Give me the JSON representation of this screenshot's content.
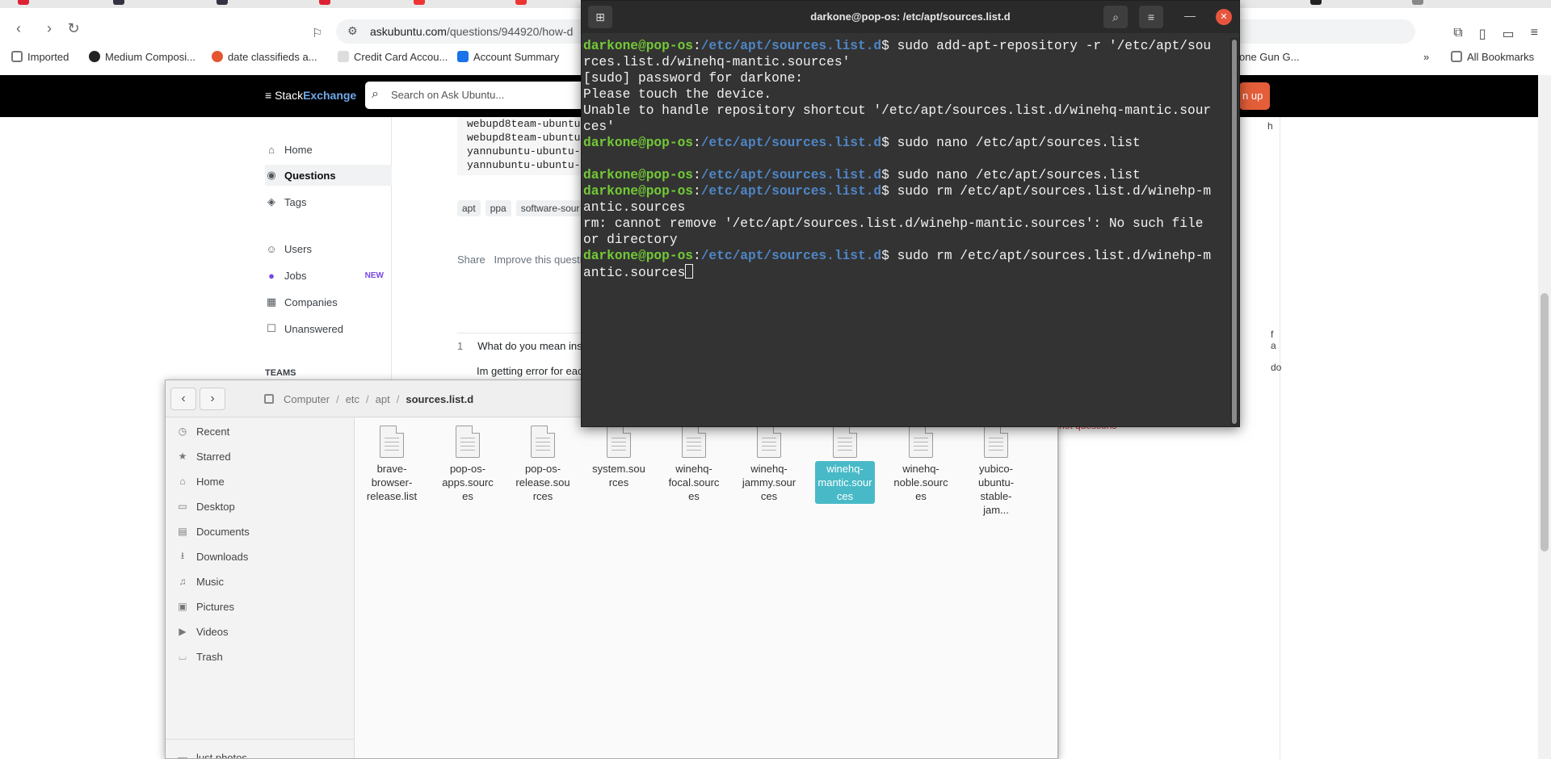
{
  "browser": {
    "url_host": "askubuntu.com",
    "url_path": "/questions/944920/how-d",
    "bookmarks": [
      {
        "label": "Imported",
        "color": "#777777"
      },
      {
        "label": "Medium Composi...",
        "color": "#222222"
      },
      {
        "label": "date classifieds a...",
        "color": "#e4572e"
      },
      {
        "label": "Credit Card Accou...",
        "color": "#bbbbbb"
      },
      {
        "label": "Account Summary",
        "color": "#1a73e8"
      },
      {
        "label": "one Gun G...",
        "color": "#777777"
      },
      {
        "label": "All Bookmarks",
        "color": "#777777"
      }
    ],
    "overflow_chevron": "»"
  },
  "site": {
    "logo_pre": "Stack",
    "logo_post": "Exchange",
    "search_placeholder": "Search on Ask Ubuntu...",
    "signup_fragment": "n up",
    "nav": [
      {
        "label": "Home",
        "icon": "home-icon"
      },
      {
        "label": "Questions",
        "icon": "questions-icon",
        "active": true
      },
      {
        "label": "Tags",
        "icon": "tag-icon"
      },
      {
        "label": "Users",
        "icon": "users-icon"
      },
      {
        "label": "Jobs",
        "icon": "jobs-icon",
        "badge": "NEW"
      },
      {
        "label": "Companies",
        "icon": "companies-icon"
      },
      {
        "label": "Unanswered",
        "icon": "unanswered-icon"
      }
    ],
    "teams_label": "TEAMS",
    "code_lines": [
      "webupd8team-ubuntu",
      "webupd8team-ubuntu",
      "yannubuntu-ubuntu-",
      "yannubuntu-ubuntu-"
    ],
    "tags": [
      "apt",
      "ppa",
      "software-sour"
    ],
    "share": "Share",
    "improve": "Improve this questio",
    "comment_score": "1",
    "comment_text": "What do you mean ins",
    "comment2_text": "Im getting error for eac",
    "right_fragments": [
      "h",
      "f a",
      "do",
      "hot questions"
    ]
  },
  "files": {
    "breadcrumb": [
      "Computer",
      "etc",
      "apt",
      "sources.list.d"
    ],
    "sidebar": [
      {
        "label": "Recent",
        "icon": "clock-icon"
      },
      {
        "label": "Starred",
        "icon": "star-icon"
      },
      {
        "label": "Home",
        "icon": "home-icon"
      },
      {
        "label": "Desktop",
        "icon": "desktop-icon"
      },
      {
        "label": "Documents",
        "icon": "documents-icon"
      },
      {
        "label": "Downloads",
        "icon": "download-icon"
      },
      {
        "label": "Music",
        "icon": "music-icon"
      },
      {
        "label": "Pictures",
        "icon": "pictures-icon"
      },
      {
        "label": "Videos",
        "icon": "videos-icon"
      },
      {
        "label": "Trash",
        "icon": "trash-icon"
      },
      {
        "label": "lust photos",
        "icon": "folder-icon"
      }
    ],
    "items": [
      {
        "label": "brave-browser-release.list"
      },
      {
        "label": "pop-os-apps.sources"
      },
      {
        "label": "pop-os-release.sources"
      },
      {
        "label": "system.sources"
      },
      {
        "label": "winehq-focal.sources"
      },
      {
        "label": "winehq-jammy.sources"
      },
      {
        "label": "winehq-mantic.sources",
        "selected": true
      },
      {
        "label": "winehq-noble.sources"
      },
      {
        "label": "yubico-ubuntu-stable-jam..."
      }
    ]
  },
  "terminal": {
    "title": "darkone@pop-os: /etc/apt/sources.list.d",
    "prompt_user": "darkone@pop-os",
    "prompt_path": "/etc/apt/sources.list.d",
    "lines": [
      {
        "type": "prompt",
        "text": "$ sudo add-apt-repository -r '/etc/apt/sou"
      },
      {
        "type": "out",
        "text": "rces.list.d/winehq-mantic.sources'"
      },
      {
        "type": "out",
        "text": "[sudo] password for darkone:"
      },
      {
        "type": "out",
        "text": "Please touch the device."
      },
      {
        "type": "out",
        "text": "Unable to handle repository shortcut '/etc/apt/sources.list.d/winehq-mantic.sour"
      },
      {
        "type": "out",
        "text": "ces'"
      },
      {
        "type": "prompt",
        "text": "$ sudo nano /etc/apt/sources.list"
      },
      {
        "type": "out",
        "text": ""
      },
      {
        "type": "prompt",
        "text": "$ sudo nano /etc/apt/sources.list"
      },
      {
        "type": "prompt",
        "text": "$ sudo rm /etc/apt/sources.list.d/winehp-m"
      },
      {
        "type": "out",
        "text": "antic.sources"
      },
      {
        "type": "out",
        "text": "rm: cannot remove '/etc/apt/sources.list.d/winehp-mantic.sources': No such file"
      },
      {
        "type": "out",
        "text": "or directory"
      },
      {
        "type": "prompt",
        "text": "$ sudo rm /etc/apt/sources.list.d/winehp-m"
      },
      {
        "type": "out",
        "text": "antic.sources",
        "cursor": true
      }
    ]
  }
}
